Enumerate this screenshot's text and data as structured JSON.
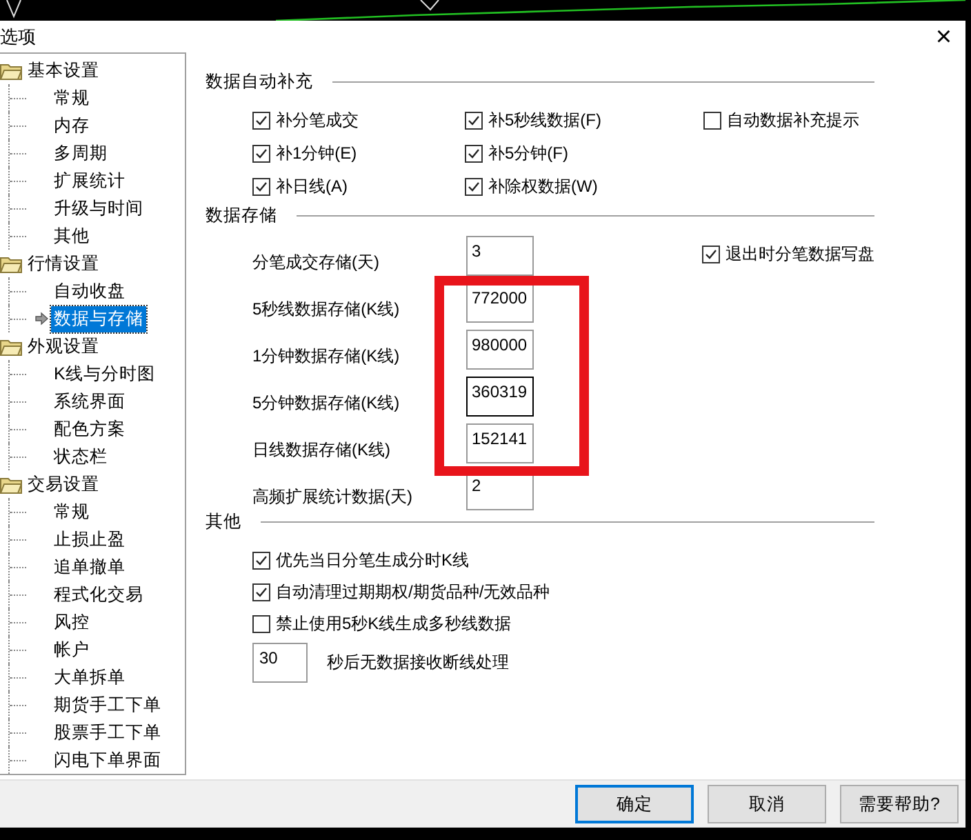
{
  "window": {
    "title": "选项",
    "close": "×"
  },
  "tree": [
    {
      "label": "基本设置",
      "expanded": true,
      "children": [
        {
          "label": "常规",
          "selected": false
        },
        {
          "label": "内存",
          "selected": false
        },
        {
          "label": "多周期",
          "selected": false
        },
        {
          "label": "扩展统计",
          "selected": false
        },
        {
          "label": "升级与时间",
          "selected": false
        },
        {
          "label": "其他",
          "selected": false
        }
      ]
    },
    {
      "label": "行情设置",
      "expanded": true,
      "children": [
        {
          "label": "自动收盘",
          "selected": false
        },
        {
          "label": "数据与存储",
          "selected": true
        }
      ]
    },
    {
      "label": "外观设置",
      "expanded": true,
      "children": [
        {
          "label": "K线与分时图",
          "selected": false
        },
        {
          "label": "系统界面",
          "selected": false
        },
        {
          "label": "配色方案",
          "selected": false
        },
        {
          "label": "状态栏",
          "selected": false
        }
      ]
    },
    {
      "label": "交易设置",
      "expanded": true,
      "children": [
        {
          "label": "常规",
          "selected": false
        },
        {
          "label": "止损止盈",
          "selected": false
        },
        {
          "label": "追单撤单",
          "selected": false
        },
        {
          "label": "程式化交易",
          "selected": false
        },
        {
          "label": "风控",
          "selected": false
        },
        {
          "label": "帐户",
          "selected": false
        },
        {
          "label": "大单拆单",
          "selected": false
        },
        {
          "label": "期货手工下单",
          "selected": false
        },
        {
          "label": "股票手工下单",
          "selected": false
        },
        {
          "label": "闪电下单界面",
          "selected": false
        }
      ]
    }
  ],
  "auto_fill": {
    "title": "数据自动补充",
    "rows": [
      [
        {
          "label": "补分笔成交",
          "checked": true
        },
        {
          "label": "补5秒线数据(F)",
          "checked": true
        },
        {
          "label": "自动数据补充提示",
          "checked": false
        }
      ],
      [
        {
          "label": "补1分钟(E)",
          "checked": true
        },
        {
          "label": "补5分钟(F)",
          "checked": true
        }
      ],
      [
        {
          "label": "补日线(A)",
          "checked": true
        },
        {
          "label": "补除权数据(W)",
          "checked": true
        }
      ]
    ]
  },
  "storage": {
    "title": "数据存储",
    "fields": [
      {
        "label": "分笔成交存储(天)",
        "value": "3",
        "focused": false
      },
      {
        "label": "5秒线数据存储(K线)",
        "value": "772000",
        "focused": false
      },
      {
        "label": "1分钟数据存储(K线)",
        "value": "980000",
        "focused": false
      },
      {
        "label": "5分钟数据存储(K线)",
        "value": "360319",
        "focused": true
      },
      {
        "label": "日线数据存储(K线)",
        "value": "152141",
        "focused": false
      },
      {
        "label": "高频扩展统计数据(天)",
        "value": "2",
        "focused": false
      }
    ],
    "exit_option": {
      "label": "退出时分笔数据写盘",
      "checked": true
    }
  },
  "other": {
    "title": "其他",
    "options": [
      {
        "label": "优先当日分笔生成分时K线",
        "checked": true
      },
      {
        "label": "自动清理过期期权/期货品种/无效品种",
        "checked": true
      },
      {
        "label": "禁止使用5秒K线生成多秒线数据",
        "checked": false
      }
    ],
    "timeout": {
      "value": "30",
      "label": "秒后无数据接收断线处理"
    }
  },
  "annotation": {
    "kind": "rectangle",
    "color": "#e8141b"
  },
  "buttons": [
    {
      "label": "确定",
      "default": true
    },
    {
      "label": "取消",
      "default": false
    },
    {
      "label": "需要帮助?",
      "default": false
    }
  ]
}
